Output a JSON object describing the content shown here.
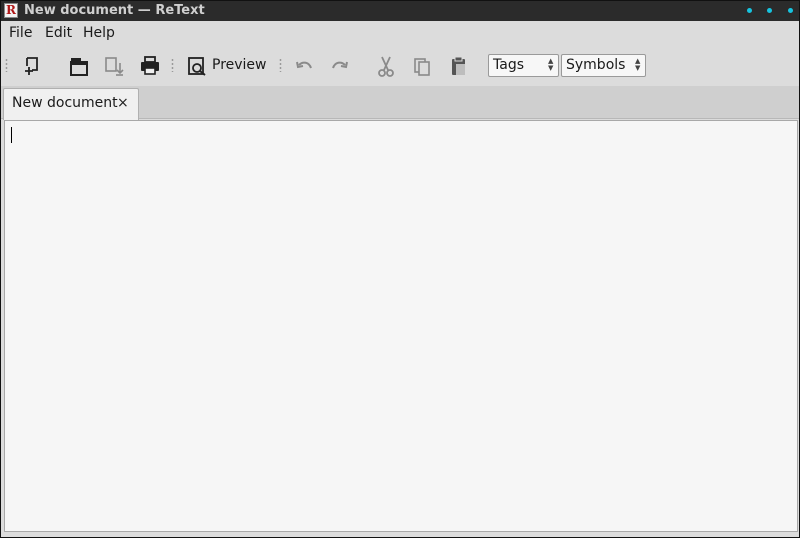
{
  "window": {
    "title": "New document — ReText",
    "app_icon_letter": "R"
  },
  "menubar": {
    "items": [
      {
        "label": "File"
      },
      {
        "label": "Edit"
      },
      {
        "label": "Help"
      }
    ]
  },
  "toolbar": {
    "buttons": [
      {
        "icon": "new-document-icon",
        "enabled": true
      },
      {
        "icon": "open-folder-icon",
        "enabled": true
      },
      {
        "icon": "save-icon",
        "enabled": false
      },
      {
        "icon": "print-icon",
        "enabled": true
      },
      {
        "icon": "preview-icon",
        "enabled": true
      },
      {
        "icon": "undo-icon",
        "enabled": false
      },
      {
        "icon": "redo-icon",
        "enabled": false
      },
      {
        "icon": "cut-icon",
        "enabled": false
      },
      {
        "icon": "copy-icon",
        "enabled": false
      },
      {
        "icon": "paste-icon",
        "enabled": true
      }
    ],
    "preview_label": "Preview",
    "tags_combo": {
      "value": "Tags"
    },
    "symbols_combo": {
      "value": "Symbols"
    }
  },
  "tabs": [
    {
      "label": "New document",
      "close_glyph": "×",
      "active": true
    }
  ],
  "editor": {
    "content": ""
  },
  "colors": {
    "titlebar_bg": "#2b2b2b",
    "window_bg": "#dcdcdc",
    "editor_bg": "#f6f6f6",
    "accent_dots": "#16c4e0"
  }
}
